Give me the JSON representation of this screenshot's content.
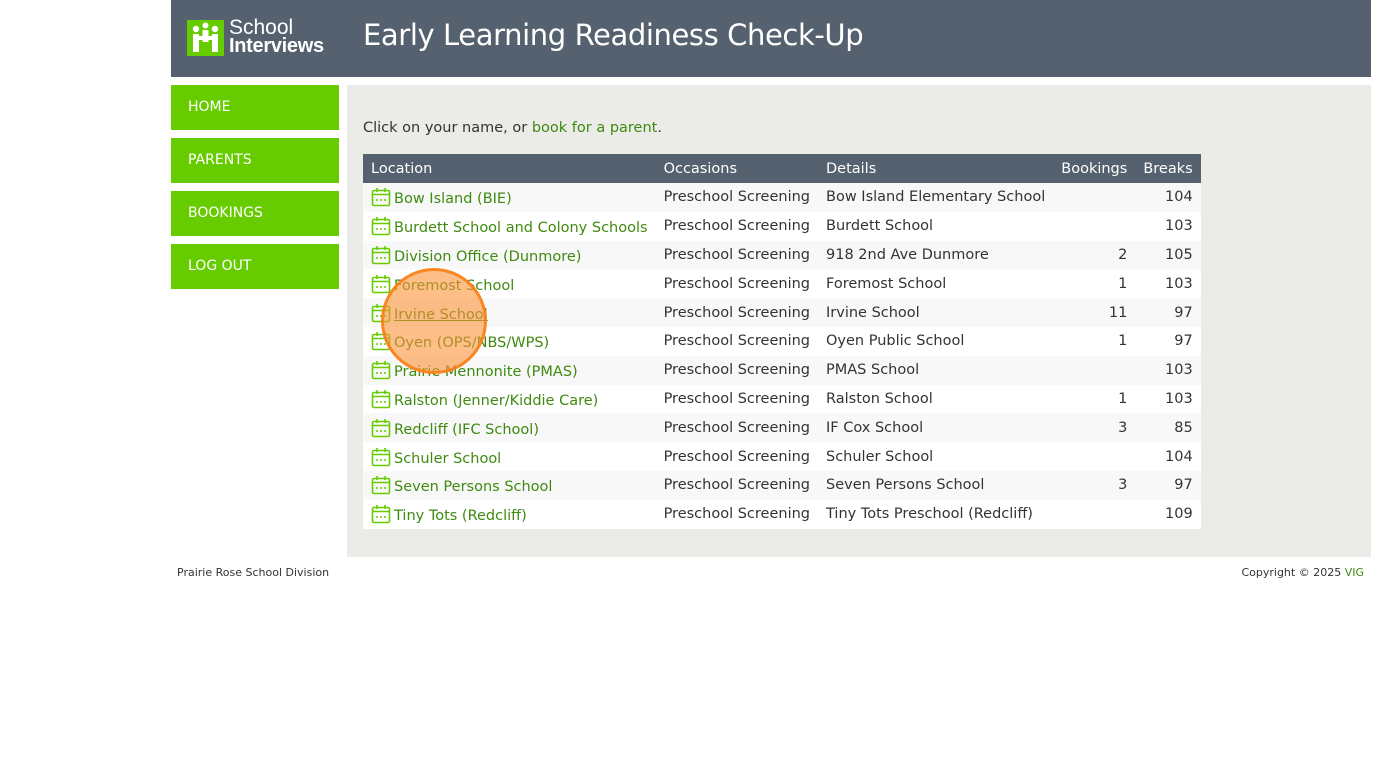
{
  "header": {
    "logo_line1": "School",
    "logo_line2": "Interviews",
    "title": "Early Learning Readiness Check-Up"
  },
  "nav": {
    "items": [
      {
        "label": "HOME"
      },
      {
        "label": "PARENTS"
      },
      {
        "label": "BOOKINGS"
      },
      {
        "label": "LOG OUT"
      }
    ]
  },
  "intro": {
    "prefix": "Click on your name, or ",
    "link": "book for a parent",
    "suffix": "."
  },
  "table": {
    "columns": [
      "Location",
      "Occasions",
      "Details",
      "Bookings",
      "Breaks"
    ],
    "rows": [
      {
        "location": "Bow Island (BIE)",
        "occasion": "Preschool Screening",
        "details": "Bow Island Elementary School",
        "bookings": "",
        "breaks": "104"
      },
      {
        "location": "Burdett School and Colony Schools",
        "occasion": "Preschool Screening",
        "details": "Burdett School",
        "bookings": "",
        "breaks": "103"
      },
      {
        "location": "Division Office (Dunmore)",
        "occasion": "Preschool Screening",
        "details": "918 2nd Ave Dunmore",
        "bookings": "2",
        "breaks": "105"
      },
      {
        "location": "Foremost School",
        "occasion": "Preschool Screening",
        "details": "Foremost School",
        "bookings": "1",
        "breaks": "103"
      },
      {
        "location": "Irvine School",
        "occasion": "Preschool Screening",
        "details": "Irvine School",
        "bookings": "11",
        "breaks": "97"
      },
      {
        "location": "Oyen (OPS/NBS/WPS)",
        "occasion": "Preschool Screening",
        "details": "Oyen Public School",
        "bookings": "1",
        "breaks": "97"
      },
      {
        "location": "Prairie Mennonite (PMAS)",
        "occasion": "Preschool Screening",
        "details": "PMAS School",
        "bookings": "",
        "breaks": "103"
      },
      {
        "location": "Ralston (Jenner/Kiddie Care)",
        "occasion": "Preschool Screening",
        "details": "Ralston School",
        "bookings": "1",
        "breaks": "103"
      },
      {
        "location": "Redcliff (IFC School)",
        "occasion": "Preschool Screening",
        "details": "IF Cox School",
        "bookings": "3",
        "breaks": "85"
      },
      {
        "location": "Schuler School",
        "occasion": "Preschool Screening",
        "details": "Schuler School",
        "bookings": "",
        "breaks": "104"
      },
      {
        "location": "Seven Persons School",
        "occasion": "Preschool Screening",
        "details": "Seven Persons School",
        "bookings": "3",
        "breaks": "97"
      },
      {
        "location": "Tiny Tots (Redcliff)",
        "occasion": "Preschool Screening",
        "details": "Tiny Tots Preschool (Redcliff)",
        "bookings": "",
        "breaks": "109"
      }
    ]
  },
  "footer": {
    "left": "Prairie Rose School Division",
    "copyright": "Copyright © 2025 ",
    "vendor": "VIG"
  },
  "icons": {
    "row_icon": "calendar-icon",
    "logo_icon": "school-interviews-logo-icon"
  },
  "colors": {
    "header_bg": "#56616f",
    "nav_green": "#66cc00",
    "link_green": "#3f8a10",
    "panel_bg": "#ebebe8",
    "click_marker": "#fc9238"
  }
}
